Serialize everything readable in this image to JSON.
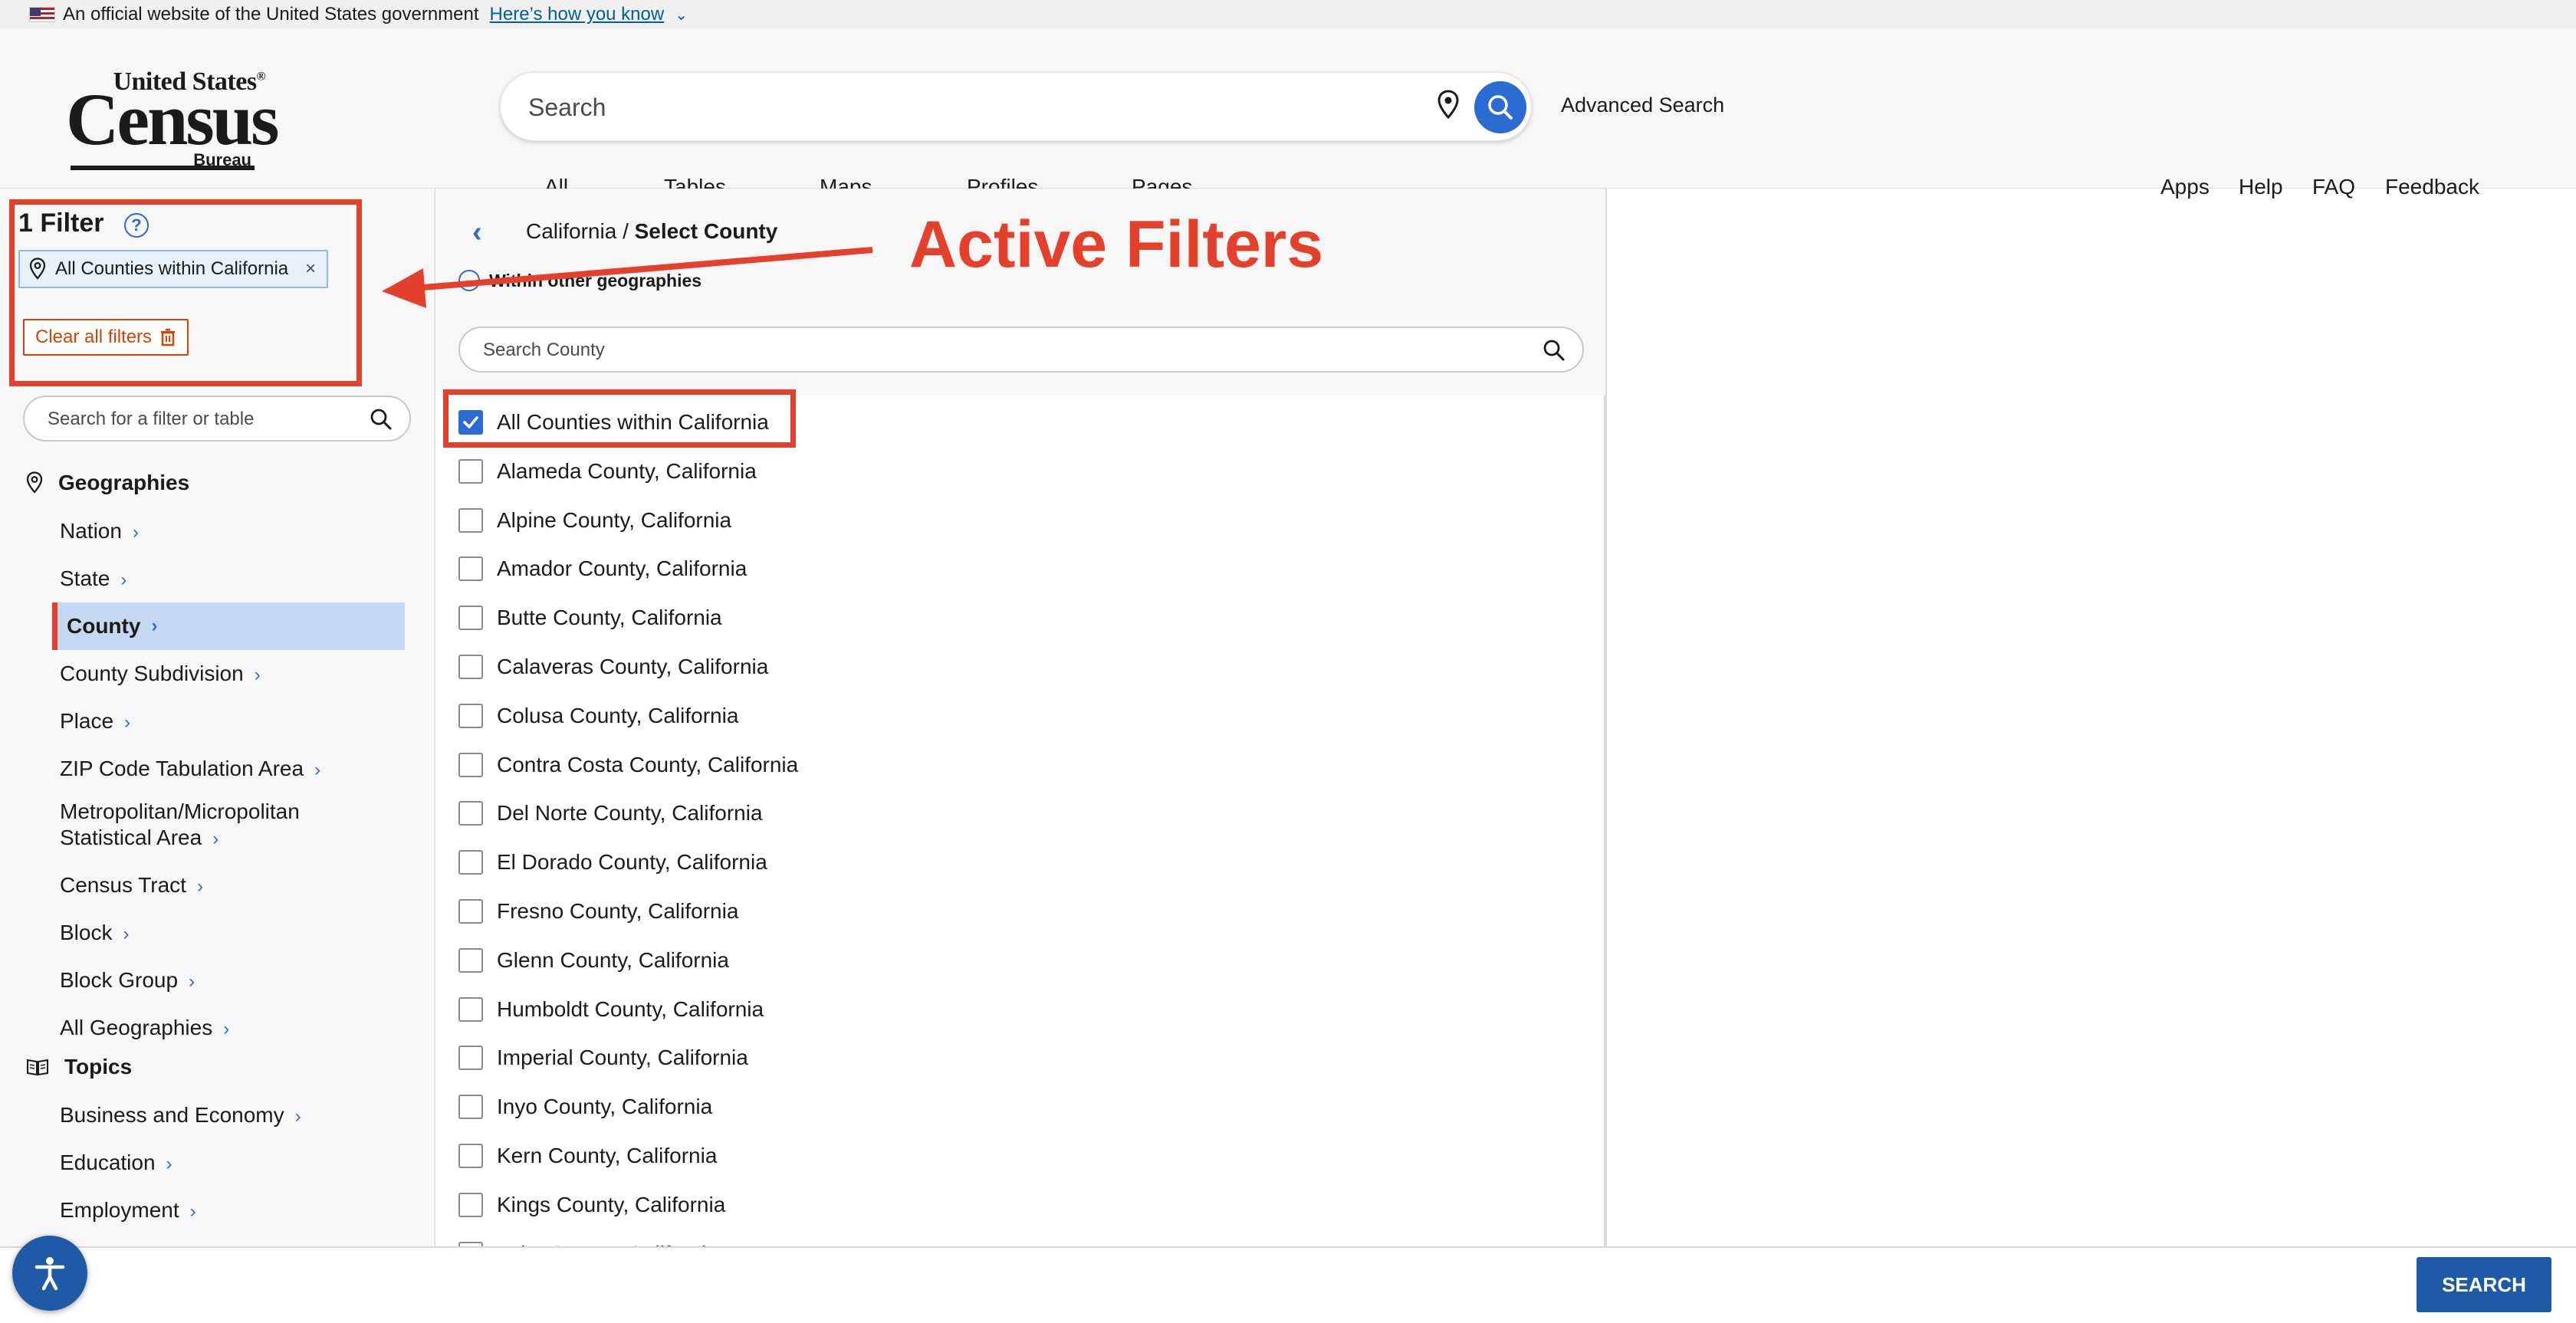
{
  "gov_banner": {
    "text": "An official website of the United States government",
    "link": "Here’s how you know"
  },
  "logo": {
    "top": "United States",
    "registered": "®",
    "main": "Census",
    "bottom": "Bureau"
  },
  "search": {
    "placeholder": "Search",
    "advanced": "Advanced Search"
  },
  "nav": {
    "left": [
      "All",
      "Tables",
      "Maps",
      "Profiles",
      "Pages"
    ],
    "right": [
      "Apps",
      "Help",
      "FAQ",
      "Feedback"
    ]
  },
  "sidebar": {
    "filter_title": "1 Filter",
    "help": "?",
    "chip_label": "All Counties within California",
    "chip_close": "×",
    "clear_label": "Clear all filters",
    "search_placeholder": "Search for a filter or table",
    "geographies_label": "Geographies",
    "geographies": [
      "Nation",
      "State",
      "County",
      "County Subdivision",
      "Place",
      "ZIP Code Tabulation Area",
      "Metropolitan/Micropolitan",
      "Statistical Area",
      "Census Tract",
      "Block",
      "Block Group",
      "All Geographies"
    ],
    "active_geography": "County",
    "topics_label": "Topics",
    "topics": [
      "Business and Economy",
      "Education",
      "Employment"
    ]
  },
  "panel": {
    "breadcrumb_parent": "California",
    "breadcrumb_sep": "/",
    "breadcrumb_current": "Select County",
    "within": "Within other geographies",
    "search_placeholder": "Search County",
    "counties": [
      "All Counties within California",
      "Alameda County, California",
      "Alpine County, California",
      "Amador County, California",
      "Butte County, California",
      "Calaveras County, California",
      "Colusa County, California",
      "Contra Costa County, California",
      "Del Norte County, California",
      "El Dorado County, California",
      "Fresno County, California",
      "Glenn County, California",
      "Humboldt County, California",
      "Imperial County, California",
      "Inyo County, California",
      "Kern County, California",
      "Kings County, California",
      "Lake County, California"
    ],
    "checked_index": 0
  },
  "annotation": {
    "text": "Active Filters",
    "color": "#e3412b"
  },
  "bottom": {
    "search_button": "SEARCH"
  },
  "colors": {
    "accent_blue": "#2b6bd2",
    "button_blue": "#1f5aa6",
    "highlight_red": "#e3412b",
    "active_bg": "#c5d8f1"
  }
}
